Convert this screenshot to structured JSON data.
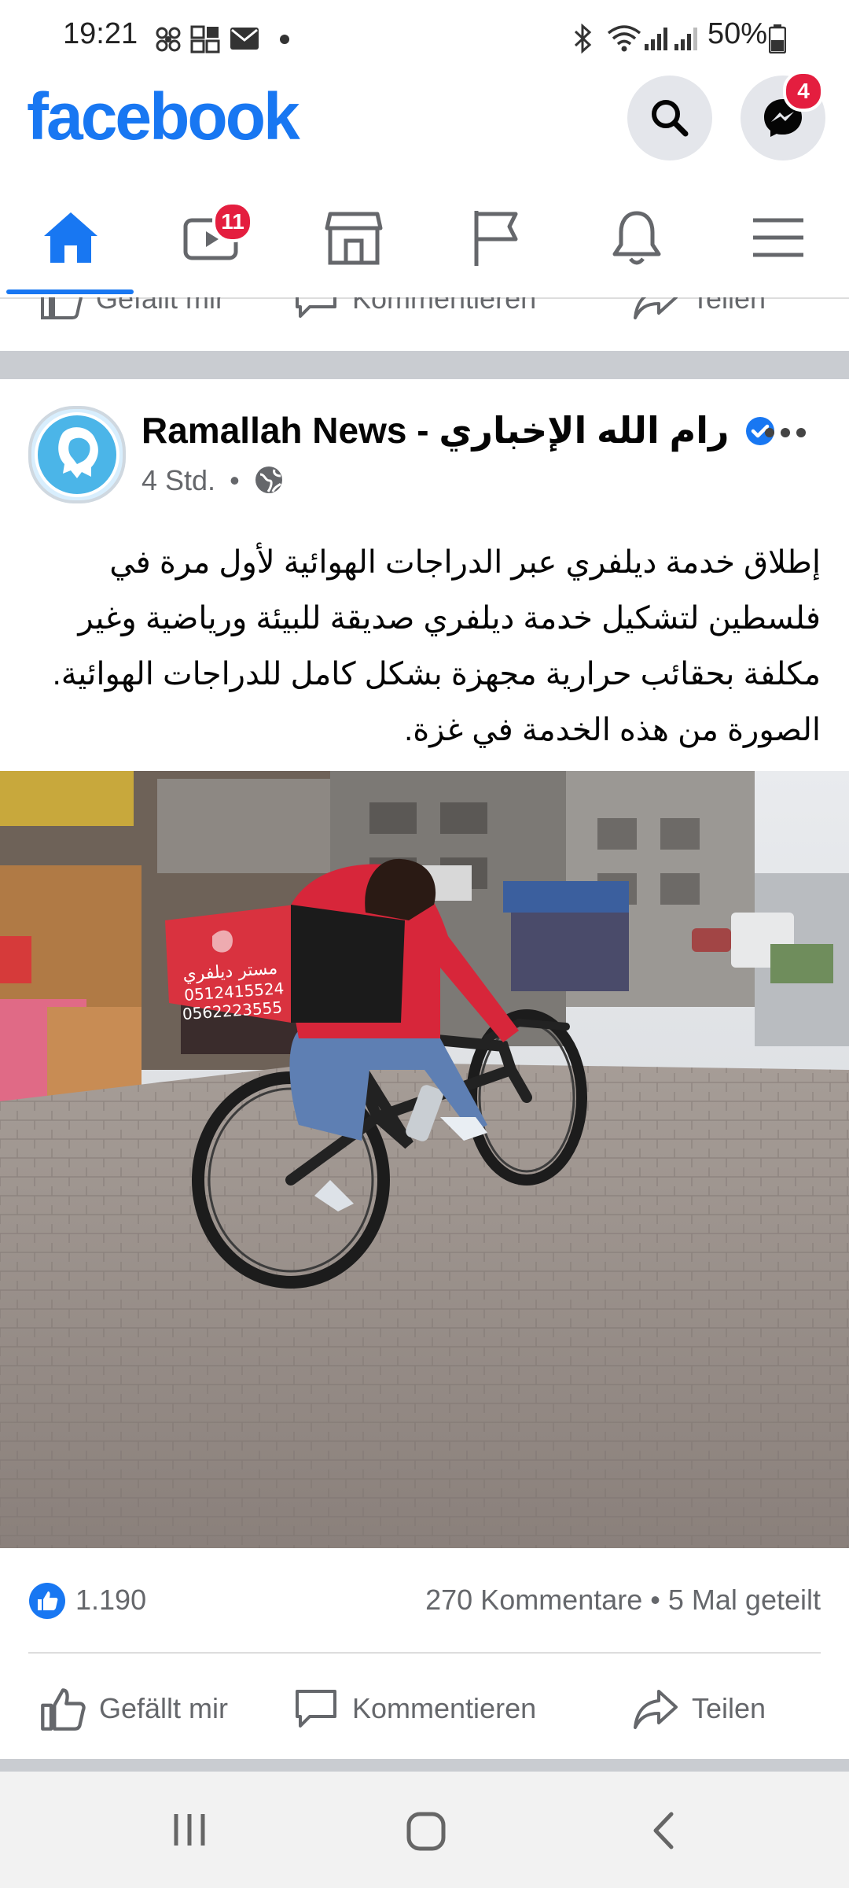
{
  "status_bar": {
    "time": "19:21",
    "battery": "50%"
  },
  "header": {
    "logo": "facebook",
    "messenger_badge": "4"
  },
  "nav": {
    "video_badge": "11"
  },
  "prev_post_actions": {
    "like": "Gefällt mir",
    "comment": "Kommentieren",
    "share": "Teilen"
  },
  "post": {
    "page_name": "Ramallah News - رام الله الإخباري",
    "time": "4 Std.",
    "text": "إطلاق خدمة ديلفري عبر الدراجات الهوائية لأول مرة في فلسطين لتشكيل خدمة ديلفري صديقة للبيئة ورياضية وغير مكلفة بحقائب حرارية مجهزة بشكل كامل للدراجات الهوائية. الصورة من هذه الخدمة في غزة.",
    "photo": {
      "bag_label": "مستر ديلفري",
      "bag_phone_1": "0512415524",
      "bag_phone_2": "0562223555"
    },
    "reactions": "1.190",
    "comments": "270 Kommentare",
    "shares": "5 Mal geteilt",
    "actions": {
      "like": "Gefällt mir",
      "comment": "Kommentieren",
      "share": "Teilen"
    }
  },
  "colors": {
    "brand": "#1877f2",
    "badge": "#e41e3f",
    "separator": "#c9ccd1"
  }
}
